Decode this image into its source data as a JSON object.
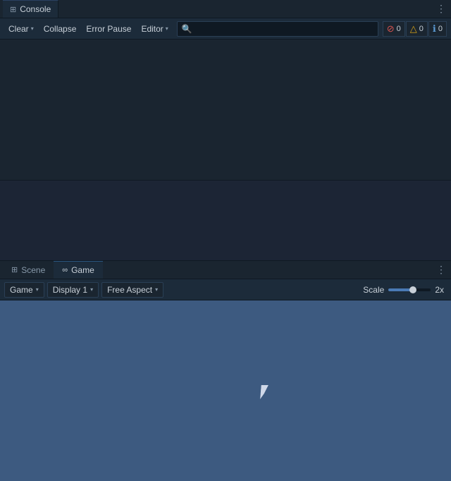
{
  "console": {
    "tab_icon": "⊞",
    "tab_label": "Console",
    "more_btn_label": "⋮",
    "toolbar": {
      "clear_label": "Clear",
      "clear_dropdown": "▾",
      "collapse_label": "Collapse",
      "error_pause_label": "Error Pause",
      "editor_label": "Editor",
      "editor_dropdown": "▾",
      "search_placeholder": "",
      "error_badge": "0",
      "warn_badge": "0",
      "info_badge": "0"
    }
  },
  "bottom_panel": {
    "more_btn_label": "⋮",
    "tabs": [
      {
        "id": "scene",
        "icon": "⊞",
        "label": "Scene",
        "active": false
      },
      {
        "id": "game",
        "icon": "∞",
        "label": "Game",
        "active": true
      }
    ],
    "toolbar": {
      "game_label": "Game",
      "game_arrow": "▾",
      "display_label": "Display 1",
      "display_arrow": "▾",
      "aspect_label": "Free Aspect",
      "aspect_arrow": "▾",
      "scale_label": "Scale",
      "scale_value": "2x"
    }
  },
  "icons": {
    "error": "⊘",
    "warn": "△",
    "info": "ℹ",
    "search": "🔍",
    "grid": "⊞",
    "game_controller": "∞"
  }
}
